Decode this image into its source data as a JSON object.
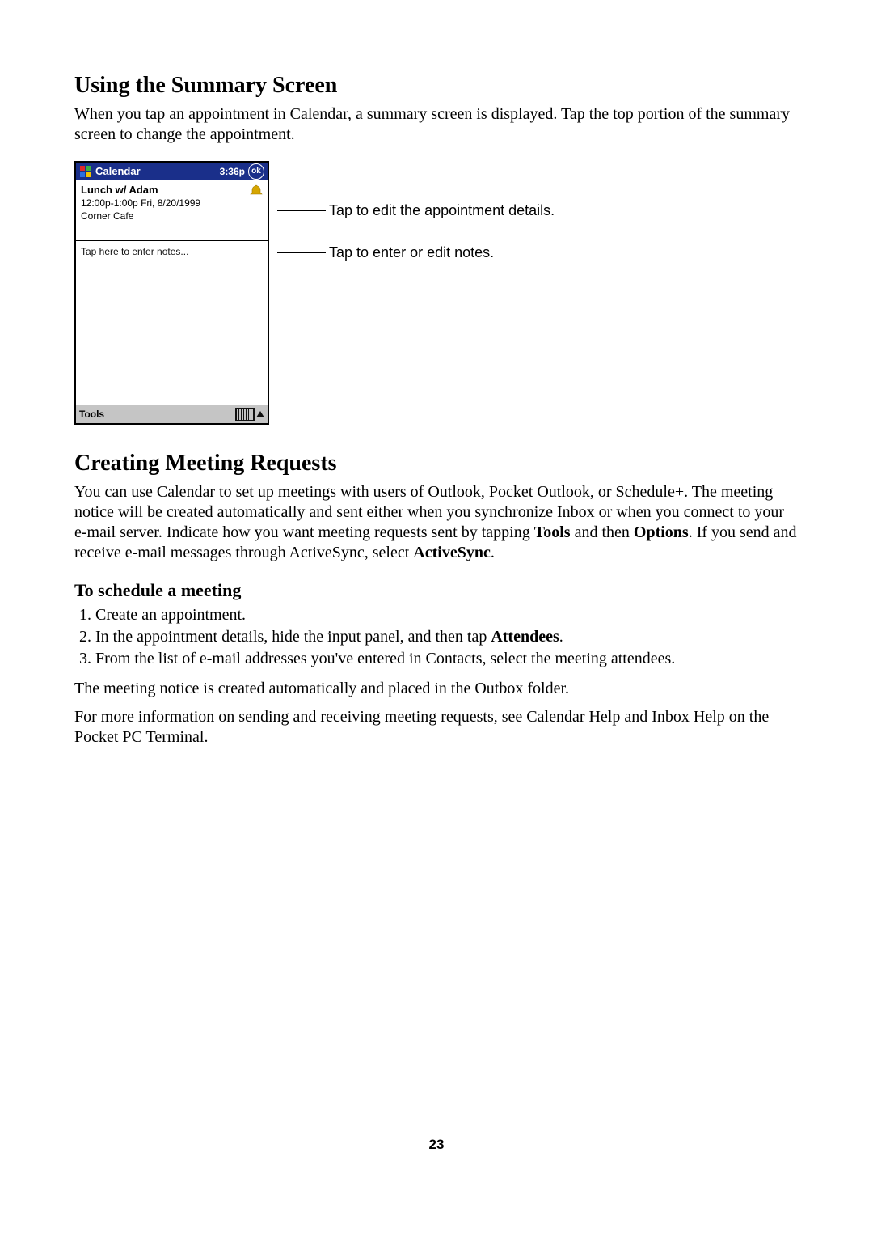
{
  "section1": {
    "heading": "Using the Summary Screen",
    "body": "When you tap an appointment in Calendar, a summary screen is displayed. Tap the top portion of the summary screen to change the appointment."
  },
  "device": {
    "app_title": "Calendar",
    "time": "3:36p",
    "ok": "ok",
    "subject": "Lunch w/ Adam",
    "timeline": "12:00p-1:00p Fri, 8/20/1999",
    "location": "Corner Cafe",
    "notes_placeholder": "Tap here to enter notes...",
    "tools": "Tools"
  },
  "callouts": {
    "c1": "Tap to edit the appointment details.",
    "c2": "Tap to enter or edit notes."
  },
  "section2": {
    "heading": "Creating Meeting Requests",
    "body_pre": "You can use Calendar to set up meetings with users of Outlook, Pocket Outlook, or Schedule+. The meeting notice will be created automatically and sent either when you synchronize Inbox or when you connect to your e-mail server. Indicate how you want meeting requests sent by tapping ",
    "tools": "Tools",
    "and_then": " and then ",
    "options": "Options",
    "body_mid": ". If you send and receive e-mail messages through ActiveSync, select ",
    "activesync": "ActiveSync",
    "body_end": "."
  },
  "subhead": "To schedule a meeting",
  "steps": {
    "s1": "Create an appointment.",
    "s2_pre": "In the appointment details, hide the input panel, and then tap ",
    "s2_bold": "Attendees",
    "s2_end": ".",
    "s3": "From the list of e-mail addresses you've entered in Contacts, select the meeting attendees."
  },
  "after1": "The meeting notice is created automatically and placed in the Outbox folder.",
  "after2": "For more information on sending and receiving meeting requests, see Calendar Help and Inbox Help on the Pocket PC Terminal.",
  "page_number": "23"
}
